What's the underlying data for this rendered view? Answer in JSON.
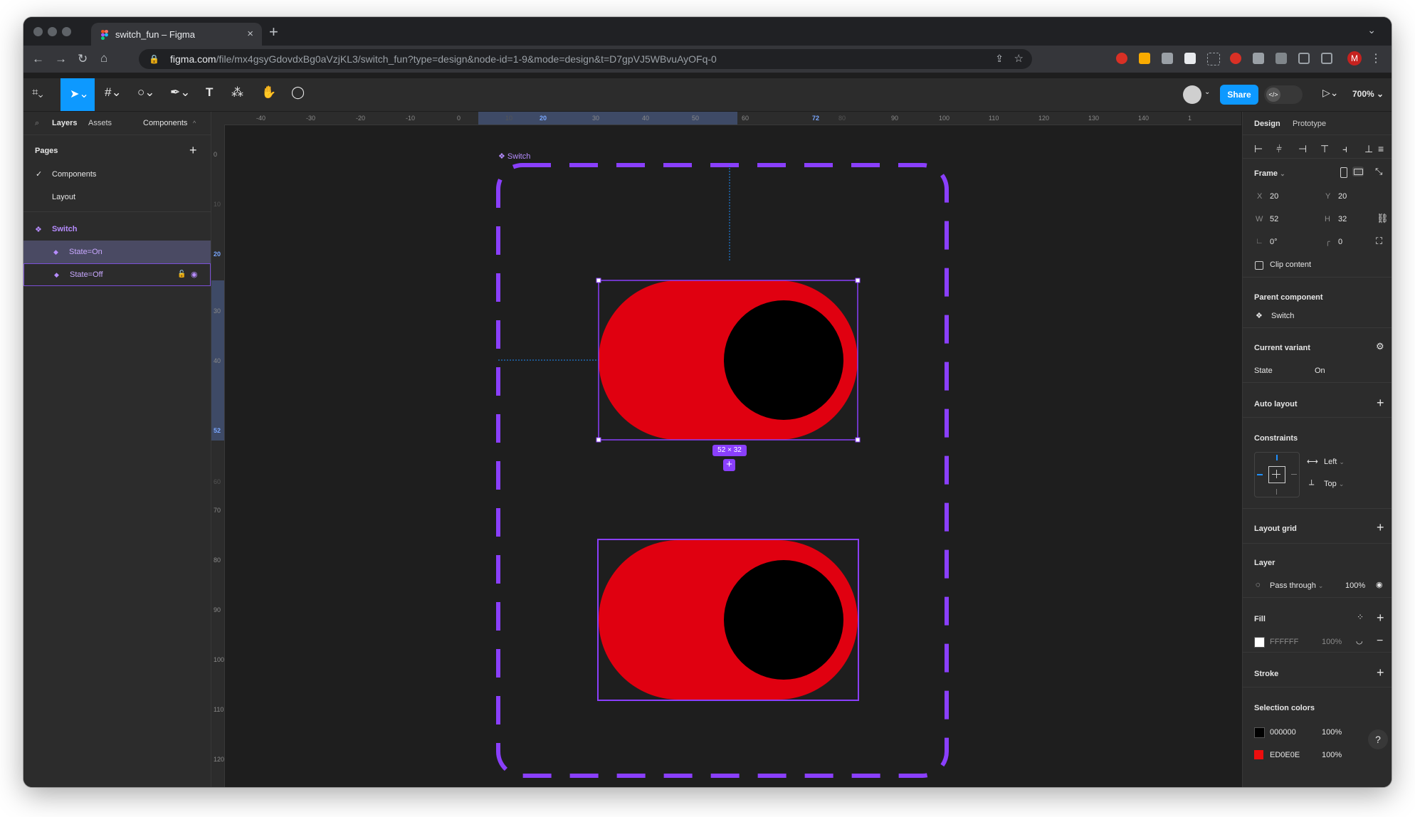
{
  "browser": {
    "tab_title": "switch_fun – Figma",
    "url_host": "figma.com",
    "url_path": "/file/mx4gsyGdovdxBg0aVzjKL3/switch_fun?type=design&node-id=1-9&mode=design&t=D7gpVJ5WBvuAyOFq-0",
    "profile_initial": "M"
  },
  "toolbar": {
    "share_label": "Share",
    "zoom_label": "700%"
  },
  "left_panel": {
    "tabs": [
      "Layers",
      "Assets",
      "Components"
    ],
    "pages_title": "Pages",
    "pages": [
      "Components",
      "Layout"
    ],
    "layers": {
      "component_set": "Switch",
      "variants": [
        "State=On",
        "State=Off"
      ]
    }
  },
  "rulers": {
    "top": [
      "-40",
      "-30",
      "-20",
      "-10",
      "0",
      "10",
      "20",
      "30",
      "40",
      "50",
      "60",
      "72",
      "80",
      "90",
      "100",
      "110",
      "120",
      "130",
      "140",
      "1"
    ],
    "left": [
      "0",
      "10",
      "20",
      "30",
      "40",
      "52",
      "60",
      "70",
      "80",
      "90",
      "100",
      "110",
      "120"
    ]
  },
  "canvas": {
    "frame_label": "Switch",
    "size_badge": "52 × 32"
  },
  "colors": {
    "accent": "#0d99ff",
    "component_purple": "#9747ff",
    "switch_red": "#ED0E0E",
    "knob": "#000000"
  },
  "right_panel": {
    "tabs": [
      "Design",
      "Prototype"
    ],
    "frame": {
      "title": "Frame",
      "x_label": "X",
      "x": "20",
      "y_label": "Y",
      "y": "20",
      "w_label": "W",
      "w": "52",
      "h_label": "H",
      "h": "32",
      "rotation": "0°",
      "radius": "0",
      "clip_label": "Clip content"
    },
    "parent_component": {
      "title": "Parent component",
      "name": "Switch"
    },
    "current_variant": {
      "title": "Current variant",
      "prop": "State",
      "value": "On"
    },
    "auto_layout": "Auto layout",
    "constraints": {
      "title": "Constraints",
      "horizontal": "Left",
      "vertical": "Top"
    },
    "layout_grid": "Layout grid",
    "layer": {
      "title": "Layer",
      "blend": "Pass through",
      "opacity": "100%"
    },
    "fill": {
      "title": "Fill",
      "hex": "FFFFFF",
      "opacity": "100%"
    },
    "stroke": "Stroke",
    "selection_colors": {
      "title": "Selection colors",
      "items": [
        {
          "hex": "000000",
          "opacity": "100%",
          "swatch": "#000000"
        },
        {
          "hex": "ED0E0E",
          "opacity": "100%",
          "swatch": "#ED0E0E"
        }
      ]
    },
    "help": "?"
  }
}
